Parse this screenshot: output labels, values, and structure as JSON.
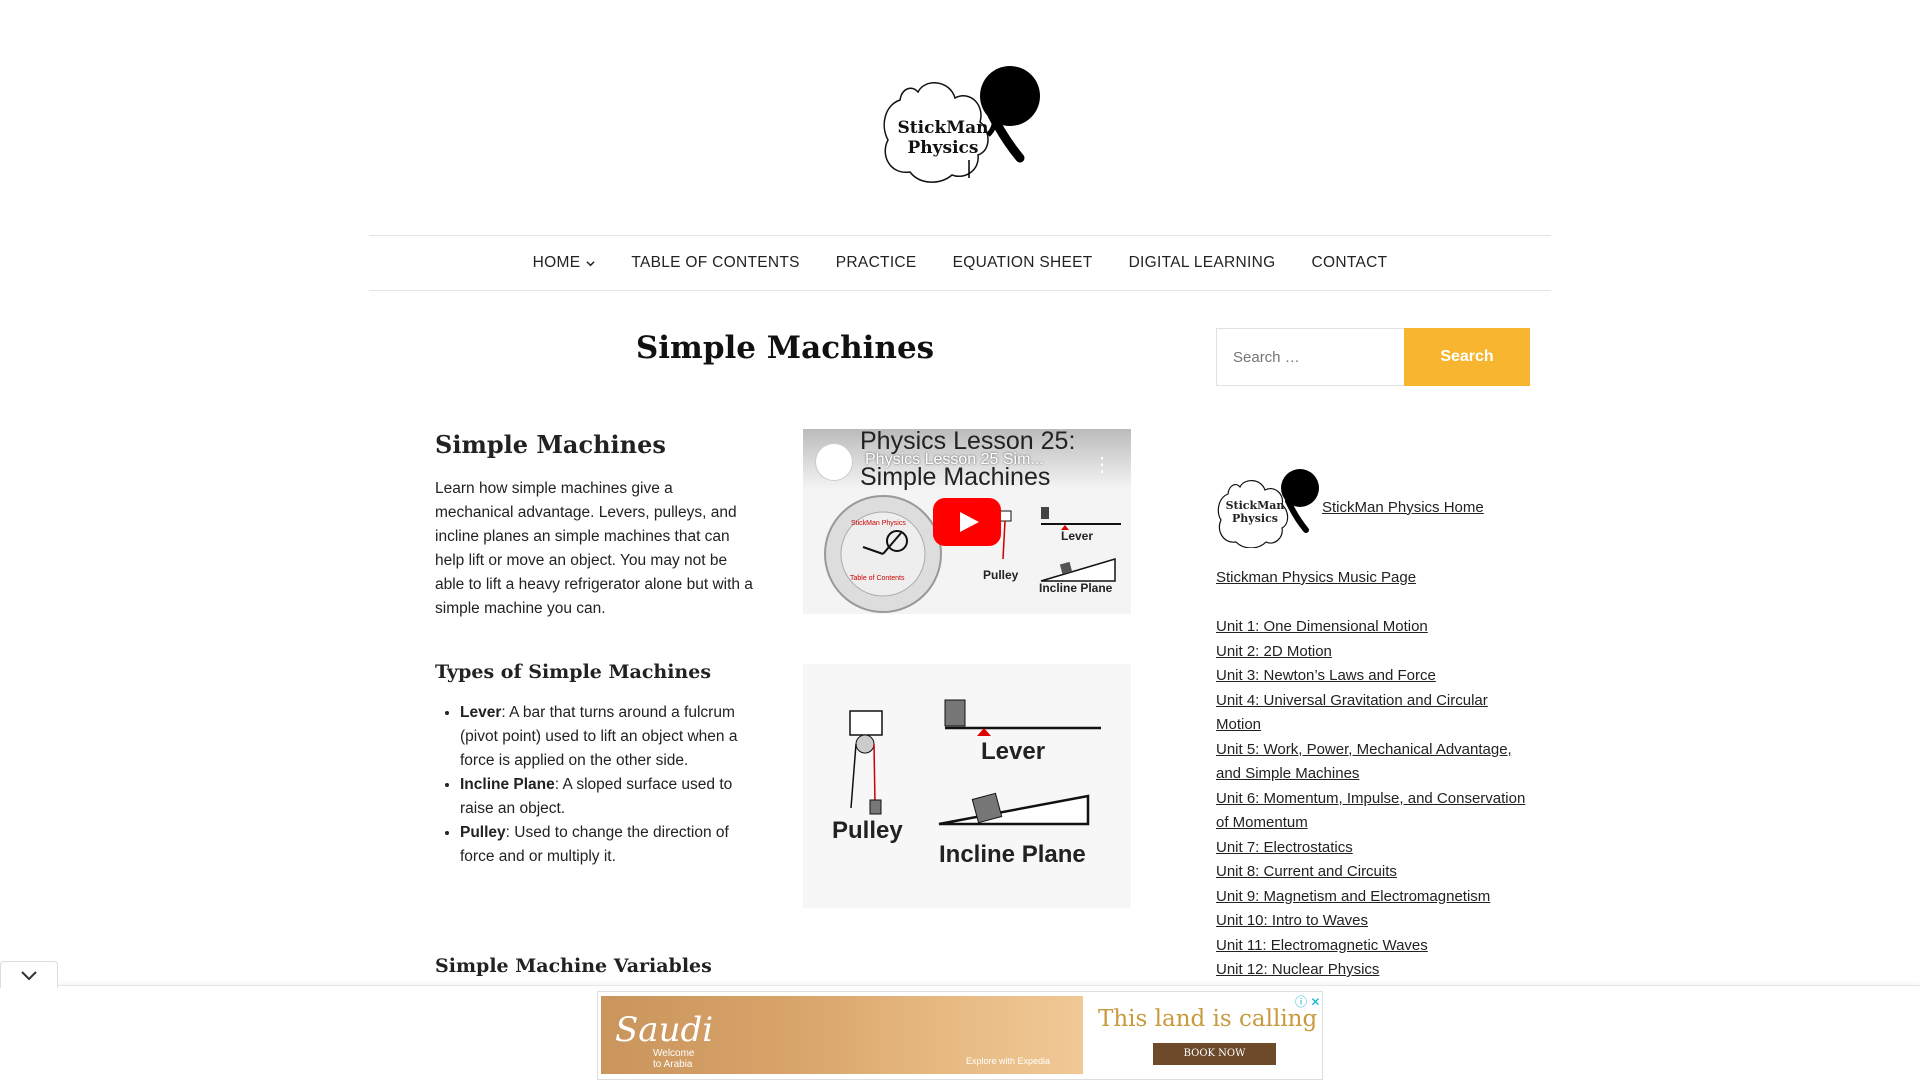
{
  "site": {
    "logo_text_line1": "StickMan",
    "logo_text_line2": "Physics"
  },
  "nav": {
    "items": [
      {
        "label": "HOME",
        "has_dropdown": true
      },
      {
        "label": "TABLE OF CONTENTS"
      },
      {
        "label": "PRACTICE"
      },
      {
        "label": "EQUATION SHEET"
      },
      {
        "label": "DIGITAL LEARNING"
      },
      {
        "label": "CONTACT"
      }
    ]
  },
  "page": {
    "title": "Simple Machines"
  },
  "content": {
    "heading": "Simple Machines",
    "intro": "Learn how simple machines give a mechanical advantage.  Levers, pulleys, and incline planes an simple machines that can help lift or move an object.  You may not be able to lift a heavy refrigerator alone but with a simple machine you can.",
    "types_heading": "Types of Simple Machines",
    "types": [
      {
        "term": "Lever",
        "desc": ": A bar that turns around a fulcrum (pivot point) used to lift an object when a force is applied on the other side."
      },
      {
        "term": "Incline Plane",
        "desc": ": A sloped surface used to raise an object."
      },
      {
        "term": "Pulley",
        "desc": ": Used to change the direction of force and or multiply it."
      }
    ],
    "variables_heading": "Simple Machine Variables"
  },
  "video": {
    "overlay_title": "Physics Lesson 25 Sim...",
    "thumb_title_line1": "Physics Lesson 25:",
    "thumb_title_line2": "Simple Machines",
    "label_lever": "Lever",
    "label_pulley": "Pulley",
    "label_incline": "Incline Plane",
    "wheel_label": "StickMan Physics",
    "wheel_center": "Table of Contents"
  },
  "illustration": {
    "label_lever": "Lever",
    "label_pulley": "Pulley",
    "label_incline": "Incline Plane"
  },
  "sidebar": {
    "search_placeholder": "Search …",
    "search_button": "Search",
    "home_link": "StickMan Physics Home",
    "music_link": "Stickman Physics Music Page",
    "units": [
      "Unit 1: One Dimensional Motion",
      "Unit 2: 2D Motion",
      "Unit 3: Newton’s Laws and Force",
      "Unit 4: Universal Gravitation and Circular Motion",
      "Unit 5: Work, Power, Mechanical Advantage, and Simple Machines",
      "Unit 6: Momentum, Impulse, and Conservation of Momentum",
      "Unit 7: Electrostatics",
      "Unit 8: Current and Circuits",
      "Unit 9: Magnetism and Electromagnetism",
      "Unit 10: Intro to Waves",
      "Unit 11: Electromagnetic Waves",
      "Unit 12: Nuclear Physics"
    ]
  },
  "ad": {
    "brand": "Saudi",
    "brand_sub_line1": "Welcome",
    "brand_sub_line2": "to Arabia",
    "partner": "Explore with  Expedia",
    "headline": "This land is calling",
    "cta": "BOOK NOW"
  },
  "colors": {
    "search_button": "#f7b530",
    "play_button": "#ff0000",
    "ad_headline": "#c89a3c"
  }
}
